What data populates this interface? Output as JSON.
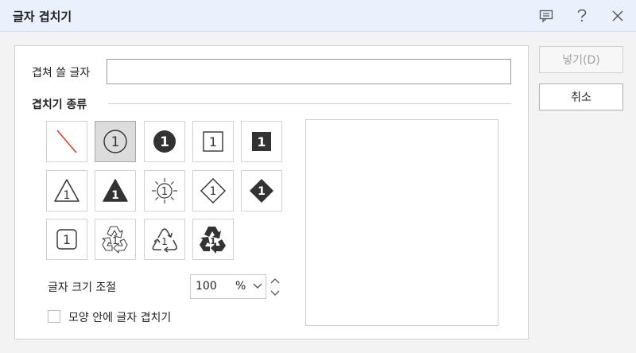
{
  "window": {
    "title": "글자 겹치기"
  },
  "titlebar_icons": [
    "comment-icon",
    "help-icon",
    "close-icon"
  ],
  "form": {
    "text_label": "겹쳐 쓸 글자",
    "text_value": "",
    "section_title": "겹치기 종류",
    "shape_types": [
      "none",
      "circle",
      "filled-circle",
      "square",
      "filled-square",
      "triangle",
      "filled-triangle",
      "sun",
      "diamond",
      "filled-diamond",
      "rounded-square",
      "recycle-outline",
      "recycle-triangle",
      "recycle-filled"
    ],
    "selected_shape": "circle",
    "glyph_char": "1",
    "size_label": "글자 크기 조절",
    "size_value": "100",
    "size_unit": "%",
    "checkbox_label": "모양 안에 글자 겹치기",
    "checkbox_checked": false
  },
  "buttons": {
    "insert_label": "넣기(D)",
    "insert_enabled": false,
    "cancel_label": "취소"
  },
  "colors": {
    "titlebar_bg": "#eaf0fc",
    "slash_red": "#e0402a",
    "shape_dark": "#333333",
    "selected_tile": "#dcdcdc"
  }
}
